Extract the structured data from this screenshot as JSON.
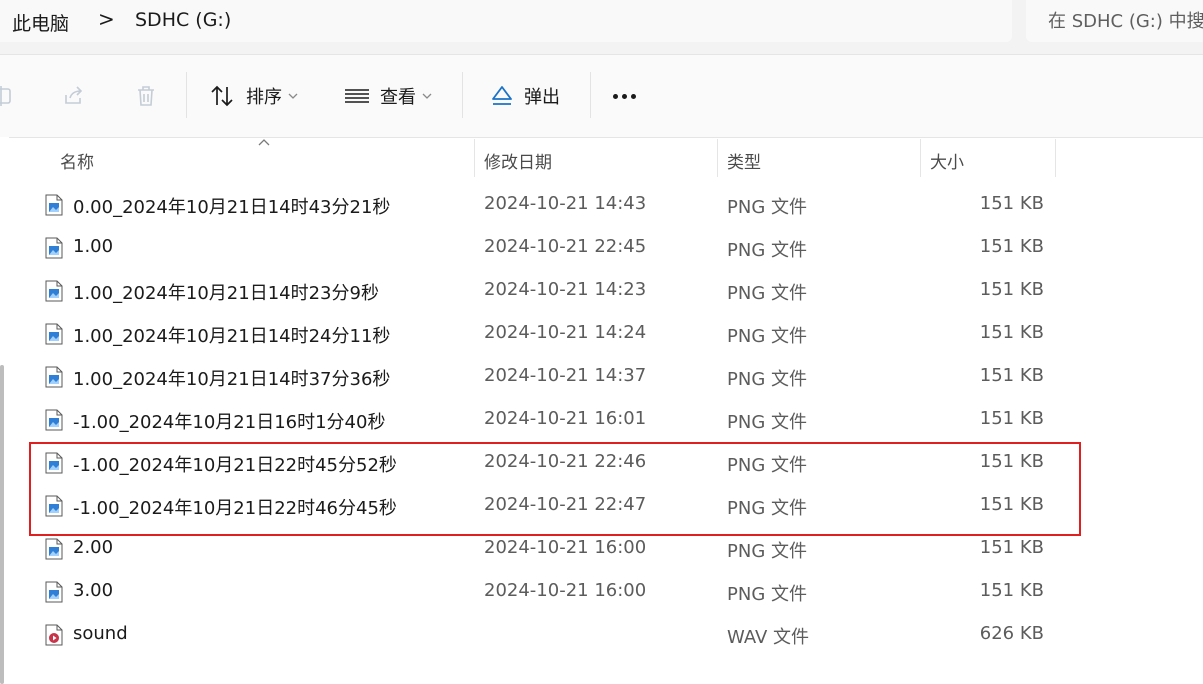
{
  "address": {
    "crumbs": [
      "此电脑",
      "SDHC (G:)"
    ],
    "separator": ">",
    "search_placeholder": "在 SDHC (G:) 中搜索"
  },
  "toolbar": {
    "sort_label": "排序",
    "view_label": "查看",
    "eject_label": "弹出",
    "more_label": "...",
    "icons": [
      "rename-icon",
      "share-icon",
      "delete-icon",
      "sort-icon",
      "view-icon",
      "eject-icon",
      "more-icon"
    ]
  },
  "columns": {
    "name": "名称",
    "date": "修改日期",
    "type": "类型",
    "size": "大小"
  },
  "files": [
    {
      "name": "0.00_2024年10月21日14时43分21秒",
      "date": "2024-10-21 14:43",
      "type": "PNG 文件",
      "size": "151 KB",
      "icon": "png"
    },
    {
      "name": "1.00",
      "date": "2024-10-21 22:45",
      "type": "PNG 文件",
      "size": "151 KB",
      "icon": "png"
    },
    {
      "name": "1.00_2024年10月21日14时23分9秒",
      "date": "2024-10-21 14:23",
      "type": "PNG 文件",
      "size": "151 KB",
      "icon": "png"
    },
    {
      "name": "1.00_2024年10月21日14时24分11秒",
      "date": "2024-10-21 14:24",
      "type": "PNG 文件",
      "size": "151 KB",
      "icon": "png"
    },
    {
      "name": "1.00_2024年10月21日14时37分36秒",
      "date": "2024-10-21 14:37",
      "type": "PNG 文件",
      "size": "151 KB",
      "icon": "png"
    },
    {
      "name": "-1.00_2024年10月21日16时1分40秒",
      "date": "2024-10-21 16:01",
      "type": "PNG 文件",
      "size": "151 KB",
      "icon": "png"
    },
    {
      "name": "-1.00_2024年10月21日22时45分52秒",
      "date": "2024-10-21 22:46",
      "type": "PNG 文件",
      "size": "151 KB",
      "icon": "png"
    },
    {
      "name": "-1.00_2024年10月21日22时46分45秒",
      "date": "2024-10-21 22:47",
      "type": "PNG 文件",
      "size": "151 KB",
      "icon": "png"
    },
    {
      "name": "2.00",
      "date": "2024-10-21 16:00",
      "type": "PNG 文件",
      "size": "151 KB",
      "icon": "png"
    },
    {
      "name": "3.00",
      "date": "2024-10-21 16:00",
      "type": "PNG 文件",
      "size": "151 KB",
      "icon": "png"
    },
    {
      "name": "sound",
      "date": "",
      "type": "WAV 文件",
      "size": "626 KB",
      "icon": "wav"
    }
  ],
  "colors": {
    "highlight_border": "#e02020",
    "png_icon_blue": "#2f7fd6",
    "wav_icon_red": "#c8344a"
  }
}
